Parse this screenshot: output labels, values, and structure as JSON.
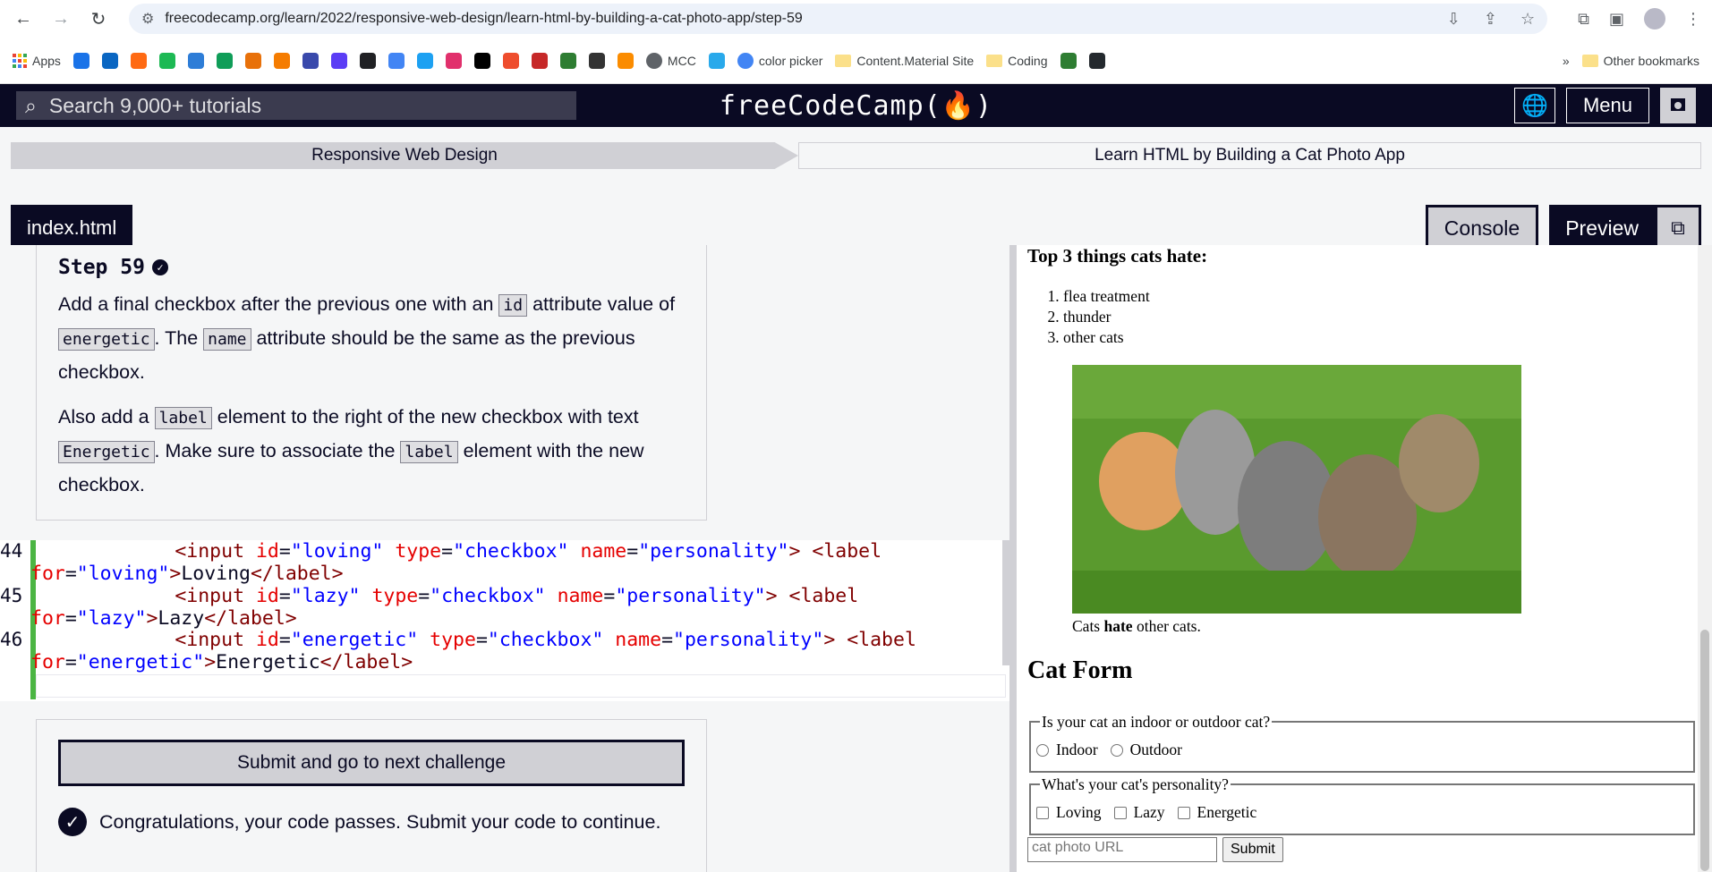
{
  "browser": {
    "url": "freecodecamp.org/learn/2022/responsive-web-design/learn-html-by-building-a-cat-photo-app/step-59",
    "bookmarks": [
      {
        "label": "Apps",
        "icon": "apps-grid-icon"
      },
      {
        "label": "",
        "icon": "blue-diamond-icon",
        "color": "#1a73e8"
      },
      {
        "label": "",
        "icon": "linkedin-icon",
        "color": "#0a66c2"
      },
      {
        "label": "",
        "icon": "b-orange-icon",
        "color": "#ff6a13"
      },
      {
        "label": "",
        "icon": "green-f-icon",
        "color": "#1db954"
      },
      {
        "label": "",
        "icon": "mb-icon",
        "color": "#2e7dd7"
      },
      {
        "label": "",
        "icon": "sheets-icon",
        "color": "#0f9d58"
      },
      {
        "label": "",
        "icon": "puzzle-color-icon",
        "color": "#e8710a"
      },
      {
        "label": "",
        "icon": "orange-chevron-icon",
        "color": "#f57c00"
      },
      {
        "label": "",
        "icon": "blue-rect-icon",
        "color": "#3949ab"
      },
      {
        "label": "",
        "icon": "play-icon",
        "color": "#5b3df5"
      },
      {
        "label": "",
        "icon": "dark-square-icon",
        "color": "#202124"
      },
      {
        "label": "",
        "icon": "blue-c-icon",
        "color": "#4285f4"
      },
      {
        "label": "",
        "icon": "x-blue-icon",
        "color": "#1da1f2"
      },
      {
        "label": "",
        "icon": "instagram-icon",
        "color": "#e1306c"
      },
      {
        "label": "",
        "icon": "tiktok-icon",
        "color": "#000000"
      },
      {
        "label": "",
        "icon": "shopify-bag-icon",
        "color": "#ee4d2d"
      },
      {
        "label": "",
        "icon": "star-badge-icon",
        "color": "#c62828"
      },
      {
        "label": "",
        "icon": "green-robot-icon",
        "color": "#2e7d32"
      },
      {
        "label": "",
        "icon": "dollar-icon",
        "color": "#333333"
      },
      {
        "label": "",
        "icon": "orange-circle-icon",
        "color": "#fb8c00"
      },
      {
        "label": "MCC",
        "icon": "globe-icon",
        "color": "#5f6368"
      },
      {
        "label": "",
        "icon": "telegram-icon",
        "color": "#29a9eb"
      },
      {
        "label": "color picker",
        "icon": "google-icon",
        "color": "#4285f4"
      },
      {
        "label": "Content.Material Site",
        "icon": "folder-icon"
      },
      {
        "label": "Coding",
        "icon": "folder-icon"
      },
      {
        "label": "",
        "icon": "ten-badge-icon",
        "color": "#2e7d32"
      },
      {
        "label": "",
        "icon": "github-icon",
        "color": "#24292e"
      }
    ],
    "more_label": "»",
    "other_bookmarks": "Other bookmarks"
  },
  "fcc": {
    "search_placeholder": "Search 9,000+ tutorials",
    "logo": "freeCodeCamp(🔥)",
    "menu": "Menu",
    "breadcrumb": [
      "Responsive Web Design",
      "Learn HTML by Building a Cat Photo App"
    ],
    "file_tab": "index.html",
    "console": "Console",
    "preview": "Preview"
  },
  "challenge": {
    "step": "Step 59",
    "p1_a": "Add a final checkbox after the previous one with an ",
    "p1_code1": "id",
    "p1_b": " attribute value of ",
    "p1_code2": "energetic",
    "p1_c": ". The ",
    "p1_code3": "name",
    "p1_d": " attribute should be the same as the previous checkbox.",
    "p2_a": "Also add a ",
    "p2_code1": "label",
    "p2_b": " element to the right of the new checkbox with text ",
    "p2_code2": "Energetic",
    "p2_c": ". Make sure to associate the ",
    "p2_code3": "label",
    "p2_d": " element with the new checkbox.",
    "submit": "Submit and go to next challenge",
    "congrats": "Congratulations, your code passes. Submit your code to continue."
  },
  "editor": {
    "lines": [
      "44",
      "45",
      "46"
    ]
  },
  "preview_page": {
    "hate_heading": "Top 3 things cats hate:",
    "hate_list": [
      "flea treatment",
      "thunder",
      "other cats"
    ],
    "caption_a": "Cats ",
    "caption_b": "hate",
    "caption_c": " other cats.",
    "form_heading": "Cat Form",
    "fieldset1_legend": "Is your cat an indoor or outdoor cat?",
    "radio1": "Indoor",
    "radio2": "Outdoor",
    "fieldset2_legend": "What's your cat's personality?",
    "check1": "Loving",
    "check2": "Lazy",
    "check3": "Energetic",
    "url_placeholder": "cat photo URL",
    "submit": "Submit"
  }
}
